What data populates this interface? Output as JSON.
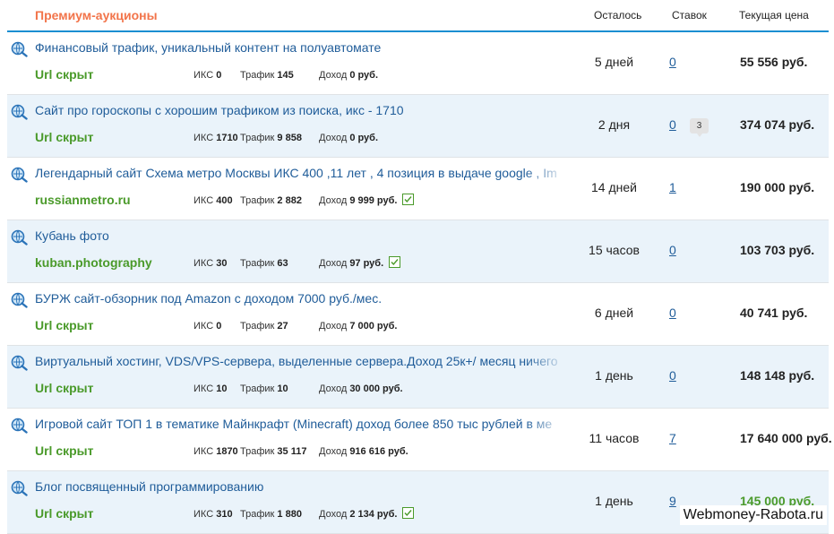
{
  "header": {
    "title": "Премиум-аукционы",
    "col_left": "Осталось",
    "col_bids": "Ставок",
    "col_price": "Текущая цена"
  },
  "rows": [
    {
      "name": "Финансовый трафик, уникальный контент на полуавтомате",
      "site": "Url скрыт",
      "iks_label": "ИКС",
      "iks": "0",
      "traffic_label": "Трафик",
      "traffic": "145",
      "income_label": "Доход",
      "income": "0 руб.",
      "verified": false,
      "left": "5 дней",
      "bids": "0",
      "comments": "",
      "price": "55 556 руб.",
      "price_green": false
    },
    {
      "name": "Сайт про гороскопы с хорошим трафиком из поиска, икс - 1710",
      "site": "Url скрыт",
      "iks_label": "ИКС",
      "iks": "1710",
      "traffic_label": "Трафик",
      "traffic": "9 858",
      "income_label": "Доход",
      "income": "0 руб.",
      "verified": false,
      "left": "2 дня",
      "bids": "0",
      "comments": "3",
      "price": "374 074 руб.",
      "price_green": false
    },
    {
      "name": "Легендарный сайт Схема метро Москвы ИКС 400 ,11 лет , 4 позиция в выдаче google , Im",
      "site": "russianmetro.ru",
      "iks_label": "ИКС",
      "iks": "400",
      "traffic_label": "Трафик",
      "traffic": "2 882",
      "income_label": "Доход",
      "income": "9 999 руб.",
      "verified": true,
      "left": "14 дней",
      "bids": "1",
      "comments": "",
      "price": "190 000 руб.",
      "price_green": false
    },
    {
      "name": "Кубань фото",
      "site": "kuban.photography",
      "iks_label": "ИКС",
      "iks": "30",
      "traffic_label": "Трафик",
      "traffic": "63",
      "income_label": "Доход",
      "income": "97 руб.",
      "verified": true,
      "left": "15 часов",
      "bids": "0",
      "comments": "",
      "price": "103 703 руб.",
      "price_green": false
    },
    {
      "name": "БУРЖ сайт-обзорник под Amazon с доходом 7000 руб./мес.",
      "site": "Url скрыт",
      "iks_label": "ИКС",
      "iks": "0",
      "traffic_label": "Трафик",
      "traffic": "27",
      "income_label": "Доход",
      "income": "7 000 руб.",
      "verified": false,
      "left": "6 дней",
      "bids": "0",
      "comments": "",
      "price": "40 741 руб.",
      "price_green": false
    },
    {
      "name": "Виртуальный хостинг, VDS/VPS-сервера, выделенные сервера.Доход 25к+/ месяц ничего",
      "site": "Url скрыт",
      "iks_label": "ИКС",
      "iks": "10",
      "traffic_label": "Трафик",
      "traffic": "10",
      "income_label": "Доход",
      "income": "30 000 руб.",
      "verified": false,
      "left": "1 день",
      "bids": "0",
      "comments": "",
      "price": "148 148 руб.",
      "price_green": false
    },
    {
      "name": "Игровой сайт ТОП 1 в тематике Майнкрафт (Minecraft) доход более 850 тыс рублей в ме",
      "site": "Url скрыт",
      "iks_label": "ИКС",
      "iks": "1870",
      "traffic_label": "Трафик",
      "traffic": "35 117",
      "income_label": "Доход",
      "income": "916 616 руб.",
      "verified": false,
      "left": "11 часов",
      "bids": "7",
      "comments": "",
      "price": "17 640 000 руб.",
      "price_green": false
    },
    {
      "name": "Блог посвященный программированию",
      "site": "Url скрыт",
      "iks_label": "ИКС",
      "iks": "310",
      "traffic_label": "Трафик",
      "traffic": "1 880",
      "income_label": "Доход",
      "income": "2 134 руб.",
      "verified": true,
      "left": "1 день",
      "bids": "9",
      "comments": "",
      "price": "145 000 руб.",
      "price_green": true
    }
  ],
  "watermark": "Webmoney-Rabota.ru",
  "colors": {
    "accent": "#1b8ed1",
    "title": "#f2744a",
    "link": "#1f5c99",
    "green": "#4a9a2a",
    "alt_row": "#eaf3fa"
  },
  "icons": {
    "row_icon": "magnifier-globe-icon",
    "check_icon": "checkmark-icon"
  }
}
